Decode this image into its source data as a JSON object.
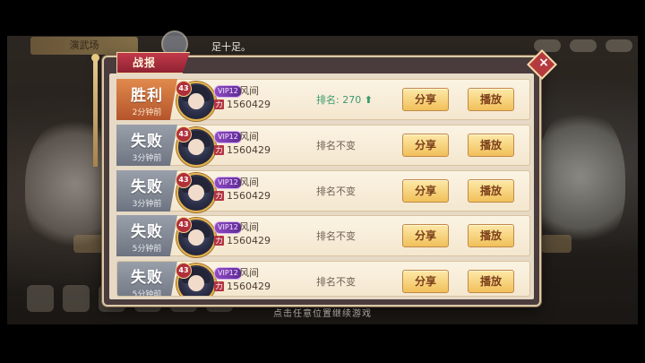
{
  "background": {
    "top_text": "足十足。",
    "banner": "演武场"
  },
  "dialog": {
    "title": "战报",
    "close": "×"
  },
  "records": [
    {
      "result": "胜利",
      "time": "2分钟前",
      "level": "43",
      "vip": "VIP12",
      "name": "风间",
      "power": "1560429",
      "rank_text": "排名: 270",
      "rank_up": "⬆",
      "share": "分享",
      "play": "播放",
      "win": true
    },
    {
      "result": "失败",
      "time": "3分钟前",
      "level": "43",
      "vip": "VIP12",
      "name": "风间",
      "power": "1560429",
      "rank_text": "排名不变",
      "rank_up": "",
      "share": "分享",
      "play": "播放",
      "win": false
    },
    {
      "result": "失败",
      "time": "3分钟前",
      "level": "43",
      "vip": "VIP12",
      "name": "风间",
      "power": "1560429",
      "rank_text": "排名不变",
      "rank_up": "",
      "share": "分享",
      "play": "播放",
      "win": false
    },
    {
      "result": "失败",
      "time": "5分钟前",
      "level": "43",
      "vip": "VIP12",
      "name": "风间",
      "power": "1560429",
      "rank_text": "排名不变",
      "rank_up": "",
      "share": "分享",
      "play": "播放",
      "win": false
    },
    {
      "result": "失败",
      "time": "5分钟前",
      "level": "43",
      "vip": "VIP12",
      "name": "风间",
      "power": "1560429",
      "rank_text": "排名不变",
      "rank_up": "",
      "share": "分享",
      "play": "播放",
      "win": false
    }
  ],
  "footer": {
    "hint": "点击任意位置继续游戏"
  }
}
